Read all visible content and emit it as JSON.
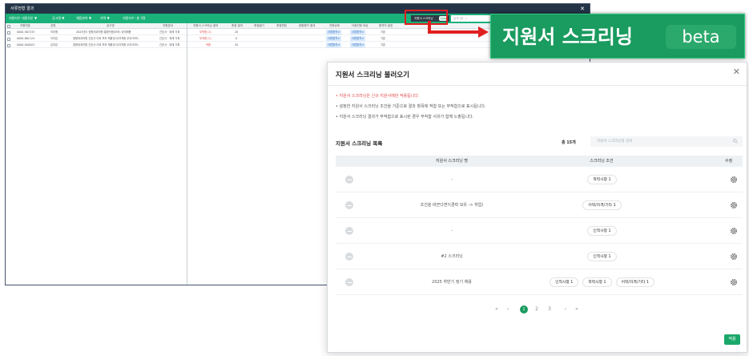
{
  "window": {
    "title": "서류전형 결과",
    "close": "✕",
    "filters": [
      "지원자수 내림차순 ▼",
      "공고명 ▼",
      "채용분야 ▼",
      "지역 ▼",
      "지원자수: 총 3명"
    ],
    "screening_button": "지원서 스크리닝",
    "screening_beta": "beta",
    "search_placeholder": "검색 (한...)"
  },
  "left_grid": {
    "headers": [
      "지원번호",
      "성명",
      "공고명",
      "지원분야"
    ],
    "rows": [
      {
        "no": "0000-567235",
        "name": "허지원",
        "title": "2025년도 정형외과의원 통합직원(보조) 공개채용",
        "field": "간호사 · 외래 기획"
      },
      {
        "no": "0000-861124",
        "name": "이지은",
        "title": "정형외과의원 간호사 이외 보조 채용공고(자격증 우대 보조)",
        "field": "간호사 · 외래 기획"
      },
      {
        "no": "0000-000003",
        "name": "김지은",
        "title": "정형외과의원 간호사 이외 보조 채용공고(자격증 우대 보조)",
        "field": "간호사 · 외래 기획"
      }
    ]
  },
  "right_grid": {
    "headers": [
      "지원서 스크리닝 결과",
      "총점 결과",
      "총점필기",
      "총점면접",
      "종합평가 결과",
      "전형상태",
      "다음전형 대상",
      "합격자 발표"
    ],
    "rows": [
      {
        "result": "부적합 (2)",
        "red": true,
        "score": "20",
        "status": "서류합격 ▾",
        "next": "서류합격 ▾",
        "pass": "기본"
      },
      {
        "result": "부적합 (2)",
        "red": true,
        "score": "0",
        "status": "서류합격 ▾",
        "next": "서류합격 ▾",
        "pass": "기본"
      },
      {
        "result": "적합",
        "red": true,
        "score": "20",
        "status": "서류합격 ▾",
        "next": "서류합격 ▾",
        "pass": "기본"
      }
    ]
  },
  "zoom": {
    "label": "지원서 스크리닝",
    "beta": "beta"
  },
  "modal": {
    "title": "지원서 스크리닝 불러오기",
    "close": "✕",
    "notices": [
      "• 지원서 스크리닝은 신규 지원서에만 적용됩니다.",
      "• 설정한 지원서 스크리닝 조건을 기준으로 결과 항목에 적합 또는 부적합으로 표시됩니다.",
      "• 지원서 스크리닝 결과가 부적합으로 표시된 경우 부적합 사유가 함께 노출됩니다."
    ],
    "list_title": "지원서 스크리닝 목록",
    "total_prefix": "총",
    "total_count": "15개",
    "search_placeholder": "지원서 스크리닝명 검색",
    "columns": {
      "name": "지원서 스크리닝 명",
      "condition": "스크리닝 조건",
      "edit": "수정"
    },
    "rows": [
      {
        "name": "-",
        "conditions": [
          "학력사항 1"
        ]
      },
      {
        "name": "조건을 바꾼다면?(경력 보유 -> 취업)",
        "conditions": [
          "어학/자격/기타 1"
        ]
      },
      {
        "name": "-",
        "conditions": [
          "인적사항 1"
        ]
      },
      {
        "name": "#2 스크리닝",
        "conditions": [
          "인적사항 1"
        ]
      },
      {
        "name": "2025 하반기 정기 채용",
        "conditions": [
          "인적사항 1",
          "학력사항 1",
          "어학/자격/기타 1"
        ]
      }
    ],
    "pagination": {
      "first": "«",
      "prev": "‹",
      "pages": [
        "1",
        "2",
        "3"
      ],
      "current": "1",
      "next": "›",
      "last": "»"
    },
    "apply": "적용"
  },
  "colors": {
    "brand_green": "#1a9b5f",
    "header_dark": "#243447",
    "highlight_red": "#e02020",
    "fail_red": "#e04a4a"
  }
}
